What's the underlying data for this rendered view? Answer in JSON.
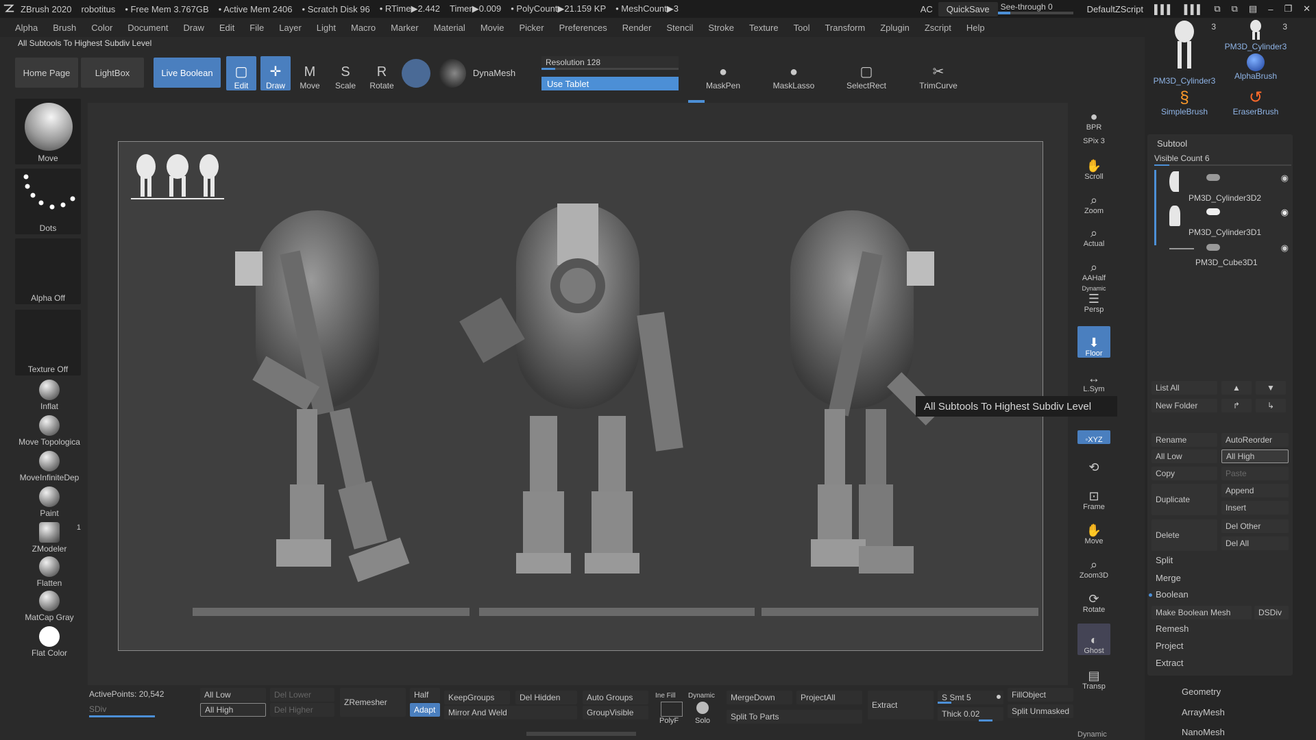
{
  "titlebar": {
    "app": "ZBrush 2020",
    "project": "robotitus",
    "free_mem": "• Free Mem 3.767GB",
    "active_mem": "• Active Mem 2406",
    "scratch": "• Scratch Disk 96",
    "rtime": "• RTime▶2.442",
    "timer": "Timer▶0.009",
    "polycount": "• PolyCount▶21.159 KP",
    "meshcount": "• MeshCount▶3",
    "ac": "AC",
    "quicksave": "QuickSave",
    "seethrough": "See-through  0",
    "seethrough_value": 0,
    "default_zscript": "DefaultZScript"
  },
  "menu": [
    "Alpha",
    "Brush",
    "Color",
    "Document",
    "Draw",
    "Edit",
    "File",
    "Layer",
    "Light",
    "Macro",
    "Marker",
    "Material",
    "Movie",
    "Picker",
    "Preferences",
    "Render",
    "Stencil",
    "Stroke",
    "Texture",
    "Tool",
    "Transform",
    "Zplugin",
    "Zscript",
    "Help"
  ],
  "status_text": "All Subtools To Highest Subdiv Level",
  "topshelf": {
    "home_page": "Home Page",
    "lightbox": "LightBox",
    "live_boolean": "Live Boolean",
    "edit": "Edit",
    "draw": "Draw",
    "move": "Move",
    "scale": "Scale",
    "rotate": "Rotate",
    "dynamesh": "DynaMesh",
    "resolution": "Resolution 128",
    "resolution_value": 128,
    "use_tablet": "Use Tablet",
    "maskpen": "MaskPen",
    "masklasso": "MaskLasso",
    "selectrect": "SelectRect",
    "trimcurve": "TrimCurve"
  },
  "leftshelf": {
    "move": "Move",
    "dots": "Dots",
    "alpha_off": "Alpha Off",
    "texture_off": "Texture Off",
    "inflat": "Inflat",
    "move_topological": "Move Topologica",
    "move_infinite": "MoveInfiniteDep",
    "paint": "Paint",
    "zmodeler": "ZModeler",
    "zmodeler_count": "1",
    "flatten": "Flatten",
    "matcap": "MatCap Gray",
    "flat_color": "Flat Color"
  },
  "rightcol": {
    "bpr": "BPR",
    "spix": "SPix 3",
    "spix_value": 3,
    "scroll": "Scroll",
    "zoom": "Zoom",
    "actual": "Actual",
    "aahalf": "AAHalf",
    "dynamic": "Dynamic",
    "persp": "Persp",
    "floor": "Floor",
    "lsym": "L.Sym",
    "xyz": "◦XYZ",
    "frame": "Frame",
    "move": "Move",
    "zoom3d": "Zoom3D",
    "rotate": "Rotate",
    "ghost": "Ghost",
    "transp": "Transp",
    "dynamic_bottom": "Dynamic"
  },
  "rightpanel": {
    "brushes": [
      {
        "label": "PM3D_Cylinder3",
        "count": "3"
      },
      {
        "label": "PM3D_Cylinder3",
        "count": "3"
      },
      {
        "label": "AlphaBrush"
      },
      {
        "label": "SimpleBrush"
      },
      {
        "label": "EraserBrush"
      }
    ],
    "subtool_title": "Subtool",
    "visible_count": "Visible Count 6",
    "subtools": [
      "PM3D_Cylinder3D2",
      "PM3D_Cylinder3D1",
      "PM3D_Cube3D1"
    ],
    "list_all": "List All",
    "new_folder": "New Folder",
    "rename": "Rename",
    "autoreorder": "AutoReorder",
    "all_low": "All Low",
    "all_high": "All High",
    "copy": "Copy",
    "paste": "Paste",
    "duplicate": "Duplicate",
    "append": "Append",
    "insert": "Insert",
    "delete": "Delete",
    "del_other": "Del Other",
    "del_all": "Del All",
    "split": "Split",
    "merge": "Merge",
    "boolean": "Boolean",
    "make_boolean_mesh": "Make Boolean Mesh",
    "dsdiv": "DSDiv",
    "remesh": "Remesh",
    "project": "Project",
    "extract": "Extract",
    "geometry": "Geometry",
    "arraymesh": "ArrayMesh",
    "nanomesh": "NanoMesh"
  },
  "tooltip": "All Subtools To Highest Subdiv Level",
  "bottomshelf": {
    "active_points": "ActivePoints: 20,542",
    "sdiv": "SDiv",
    "all_low": "All Low",
    "all_high": "All High",
    "del_lower": "Del Lower",
    "del_higher": "Del Higher",
    "zremesher": "ZRemesher",
    "half": "Half",
    "adapt": "Adapt",
    "keepgroups": "KeepGroups",
    "mirror_and_weld": "Mirror And Weld",
    "del_hidden": "Del Hidden",
    "auto_groups": "Auto Groups",
    "groupvisible": "GroupVisible",
    "line_fill": "Ine Fill",
    "polyf": "PolyF",
    "dynamic": "Dynamic",
    "solo": "Solo",
    "mergedown": "MergeDown",
    "projectall": "ProjectAll",
    "split_to_parts": "Split To Parts",
    "extract": "Extract",
    "s_smt": "S Smt 5",
    "thick": "Thick 0.02",
    "fillobject": "FillObject",
    "split_unmasked": "Split Unmasked"
  },
  "colors": {
    "accent": "#4a7fbf",
    "background": "#2a2a2a",
    "canvas": "#3f3f3f"
  }
}
